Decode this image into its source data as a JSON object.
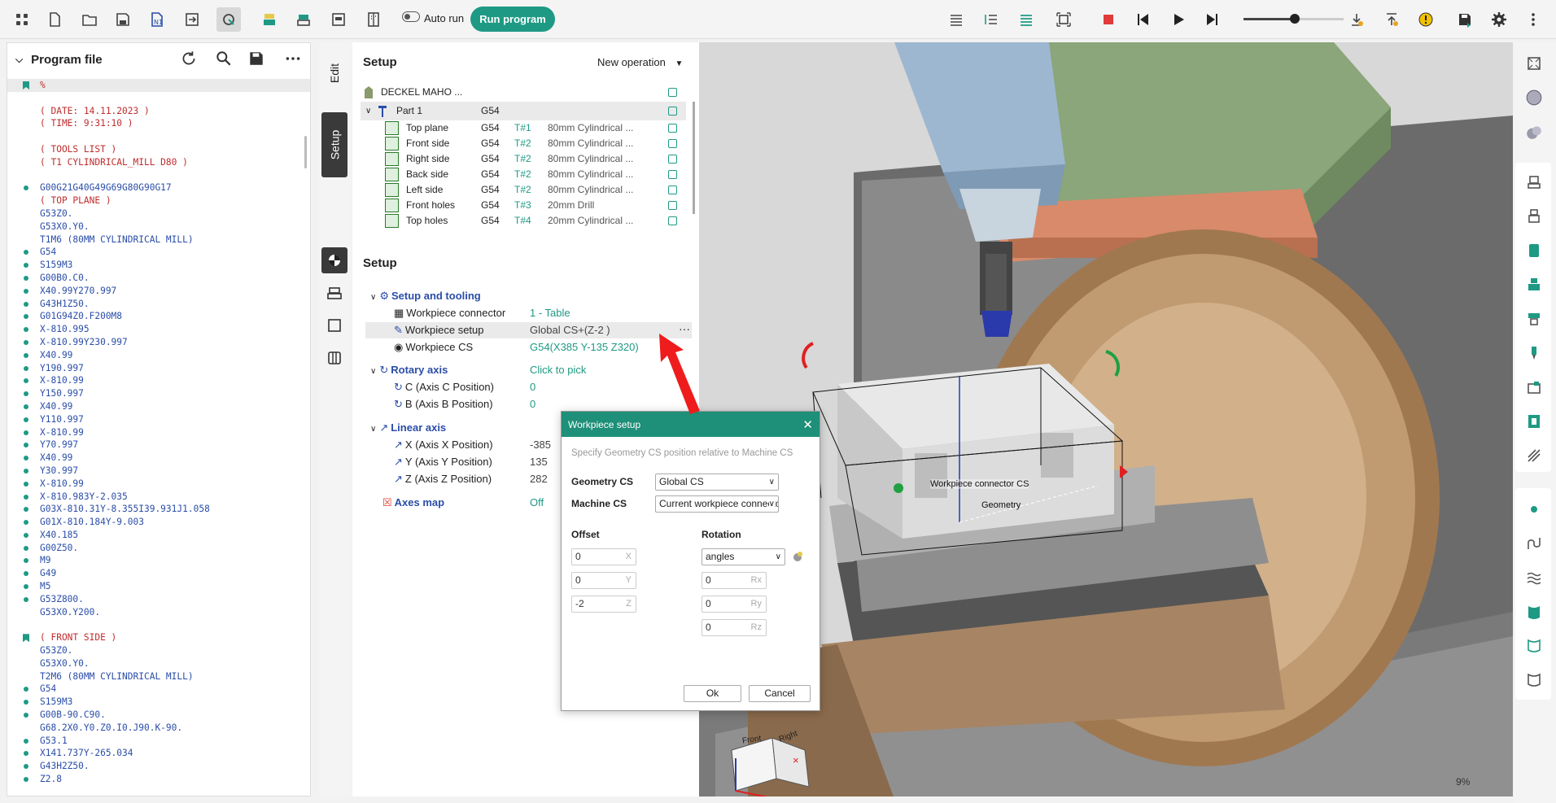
{
  "toolbar": {
    "auto_run_label": "Auto run",
    "run_program_label": "Run program"
  },
  "program_panel": {
    "title": "Program file",
    "lines": [
      {
        "text": "%",
        "marker": "bookmark",
        "style": "pct"
      },
      {
        "text": "",
        "marker": "",
        "style": ""
      },
      {
        "text": "( DATE: 14.11.2023 )",
        "marker": "",
        "style": "c"
      },
      {
        "text": "( TIME: 9:31:10 )",
        "marker": "",
        "style": "c"
      },
      {
        "text": "",
        "marker": "",
        "style": ""
      },
      {
        "text": "( TOOLS LIST )",
        "marker": "",
        "style": "c"
      },
      {
        "text": "( T1 CYLINDRICAL_MILL D80 )",
        "marker": "",
        "style": "c"
      },
      {
        "text": "",
        "marker": "",
        "style": ""
      },
      {
        "text": "G00G21G40G49G69G80G90G17",
        "marker": "dot",
        "style": ""
      },
      {
        "text": "( TOP PLANE )",
        "marker": "",
        "style": "c"
      },
      {
        "text": "G53Z0.",
        "marker": "",
        "style": ""
      },
      {
        "text": "G53X0.Y0.",
        "marker": "",
        "style": ""
      },
      {
        "text": "T1M6 (80MM CYLINDRICAL MILL)",
        "marker": "",
        "style": ""
      },
      {
        "text": "G54",
        "marker": "dot",
        "style": ""
      },
      {
        "text": "S159M3",
        "marker": "dot",
        "style": ""
      },
      {
        "text": "G00B0.C0.",
        "marker": "dot",
        "style": ""
      },
      {
        "text": "X40.99Y270.997",
        "marker": "dot",
        "style": ""
      },
      {
        "text": "G43H1Z50.",
        "marker": "dot",
        "style": ""
      },
      {
        "text": "G01G94Z0.F200M8",
        "marker": "dot",
        "style": ""
      },
      {
        "text": "X-810.995",
        "marker": "dot",
        "style": ""
      },
      {
        "text": "X-810.99Y230.997",
        "marker": "dot",
        "style": ""
      },
      {
        "text": "X40.99",
        "marker": "dot",
        "style": ""
      },
      {
        "text": "Y190.997",
        "marker": "dot",
        "style": ""
      },
      {
        "text": "X-810.99",
        "marker": "dot",
        "style": ""
      },
      {
        "text": "Y150.997",
        "marker": "dot",
        "style": ""
      },
      {
        "text": "X40.99",
        "marker": "dot",
        "style": ""
      },
      {
        "text": "Y110.997",
        "marker": "dot",
        "style": ""
      },
      {
        "text": "X-810.99",
        "marker": "dot",
        "style": ""
      },
      {
        "text": "Y70.997",
        "marker": "dot",
        "style": ""
      },
      {
        "text": "X40.99",
        "marker": "dot",
        "style": ""
      },
      {
        "text": "Y30.997",
        "marker": "dot",
        "style": ""
      },
      {
        "text": "X-810.99",
        "marker": "dot",
        "style": ""
      },
      {
        "text": "X-810.983Y-2.035",
        "marker": "dot",
        "style": ""
      },
      {
        "text": "G03X-810.31Y-8.355I39.931J1.058",
        "marker": "dot",
        "style": ""
      },
      {
        "text": "G01X-810.184Y-9.003",
        "marker": "dot",
        "style": ""
      },
      {
        "text": "X40.185",
        "marker": "dot",
        "style": ""
      },
      {
        "text": "G00Z50.",
        "marker": "dot",
        "style": ""
      },
      {
        "text": "M9",
        "marker": "dot",
        "style": ""
      },
      {
        "text": "G49",
        "marker": "dot",
        "style": ""
      },
      {
        "text": "M5",
        "marker": "dot",
        "style": ""
      },
      {
        "text": "G53Z800.",
        "marker": "dot",
        "style": ""
      },
      {
        "text": "G53X0.Y200.",
        "marker": "",
        "style": ""
      },
      {
        "text": "",
        "marker": "",
        "style": ""
      },
      {
        "text": "( FRONT SIDE )",
        "marker": "bookmark",
        "style": "c"
      },
      {
        "text": "G53Z0.",
        "marker": "",
        "style": ""
      },
      {
        "text": "G53X0.Y0.",
        "marker": "",
        "style": ""
      },
      {
        "text": "T2M6 (80MM CYLINDRICAL MILL)",
        "marker": "",
        "style": ""
      },
      {
        "text": "G54",
        "marker": "dot",
        "style": ""
      },
      {
        "text": "S159M3",
        "marker": "dot",
        "style": ""
      },
      {
        "text": "G00B-90.C90.",
        "marker": "dot",
        "style": ""
      },
      {
        "text": "G68.2X0.Y0.Z0.I0.J90.K-90.",
        "marker": "",
        "style": ""
      },
      {
        "text": "G53.1",
        "marker": "dot",
        "style": ""
      },
      {
        "text": "X141.737Y-265.034",
        "marker": "dot",
        "style": ""
      },
      {
        "text": "G43H2Z50.",
        "marker": "dot",
        "style": ""
      },
      {
        "text": "Z2.8",
        "marker": "dot",
        "style": ""
      }
    ]
  },
  "side_tabs": {
    "edit": "Edit",
    "setup": "Setup"
  },
  "operations": {
    "title": "Setup",
    "new_operation": "New operation",
    "machine": "DECKEL MAHO ...",
    "part": {
      "name": "Part 1",
      "cs": "G54"
    },
    "rows": [
      {
        "name": "Top plane",
        "cs": "G54",
        "tool": "T#1",
        "desc": "80mm Cylindrical ..."
      },
      {
        "name": "Front side",
        "cs": "G54",
        "tool": "T#2",
        "desc": "80mm Cylindrical ..."
      },
      {
        "name": "Right side",
        "cs": "G54",
        "tool": "T#2",
        "desc": "80mm Cylindrical ..."
      },
      {
        "name": "Back side",
        "cs": "G54",
        "tool": "T#2",
        "desc": "80mm Cylindrical ..."
      },
      {
        "name": "Left side",
        "cs": "G54",
        "tool": "T#2",
        "desc": "80mm Cylindrical ..."
      },
      {
        "name": "Front holes",
        "cs": "G54",
        "tool": "T#3",
        "desc": "20mm Drill"
      },
      {
        "name": "Top holes",
        "cs": "G54",
        "tool": "T#4",
        "desc": "20mm Cylindrical ..."
      }
    ]
  },
  "setup": {
    "title": "Setup",
    "setup_and_tooling": "Setup and tooling",
    "workpiece_connector_label": "Workpiece connector",
    "workpiece_connector_value": "1 - Table",
    "workpiece_setup_label": "Workpiece setup",
    "workpiece_setup_value": "Global CS+(Z-2 )",
    "workpiece_cs_label": "Workpiece CS",
    "workpiece_cs_value": "G54(X385 Y-135 Z320)",
    "rotary_axis": "Rotary axis",
    "rotary_value": "Click to pick",
    "c_axis_label": "C (Axis C Position)",
    "c_axis_value": "0",
    "b_axis_label": "B (Axis B Position)",
    "b_axis_value": "0",
    "linear_axis": "Linear axis",
    "x_axis_label": "X (Axis X Position)",
    "x_axis_value": "-385",
    "y_axis_label": "Y (Axis Y Position)",
    "y_axis_value": "135",
    "z_axis_label": "Z (Axis Z Position)",
    "z_axis_value": "282",
    "axes_map_label": "Axes map",
    "axes_map_value": "Off"
  },
  "dialog": {
    "title": "Workpiece setup",
    "description": "Specify Geometry CS position relative to Machine CS",
    "geometry_cs_label": "Geometry CS",
    "geometry_cs_value": "Global CS",
    "machine_cs_label": "Machine CS",
    "machine_cs_value": "Current workpiece connector CS",
    "offset_label": "Offset",
    "offset_x": "0",
    "offset_y": "0",
    "offset_z": "-2",
    "axis_x": "X",
    "axis_y": "Y",
    "axis_z": "Z",
    "rotation_label": "Rotation",
    "rotation_mode": "angles",
    "rot_x": "0",
    "rot_y": "0",
    "rot_z": "0",
    "axis_rx": "Rx",
    "axis_ry": "Ry",
    "axis_rz": "Rz",
    "ok_label": "Ok",
    "cancel_label": "Cancel"
  },
  "viewport": {
    "label_connector": "Workpiece connector CS",
    "label_geometry": "Geometry",
    "cube_front": "Front",
    "cube_right": "Right",
    "zoom": "9%"
  },
  "colors": {
    "accent": "#1e9a84",
    "code_blue": "#2a4da8",
    "comment_red": "#c02b2b"
  }
}
